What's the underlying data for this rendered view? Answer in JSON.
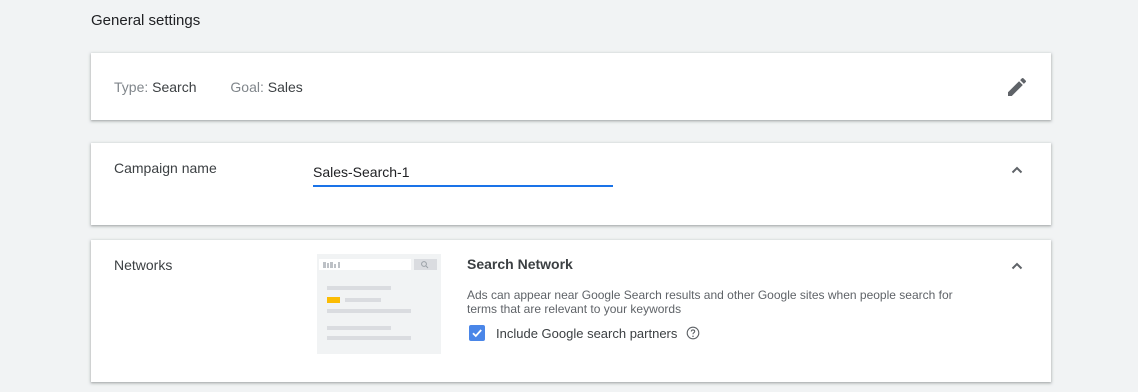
{
  "section": {
    "title": "General settings"
  },
  "summary": {
    "type_label": "Type:",
    "type_value": "Search",
    "goal_label": "Goal:",
    "goal_value": "Sales"
  },
  "campaign_name": {
    "label": "Campaign name",
    "value": "Sales-Search-1"
  },
  "networks": {
    "label": "Networks",
    "title": "Search Network",
    "description": "Ads can appear near Google Search results and other Google sites when people search for terms that are relevant to your keywords",
    "partners_label": "Include Google search partners",
    "partners_checked": true
  },
  "colors": {
    "accent": "#1a73e8",
    "checkbox": "#4a86e8",
    "ad_highlight": "#fbbc04"
  },
  "icons": [
    "edit-pencil-icon",
    "chevron-up-icon",
    "help-circle-icon",
    "checkmark-icon"
  ]
}
